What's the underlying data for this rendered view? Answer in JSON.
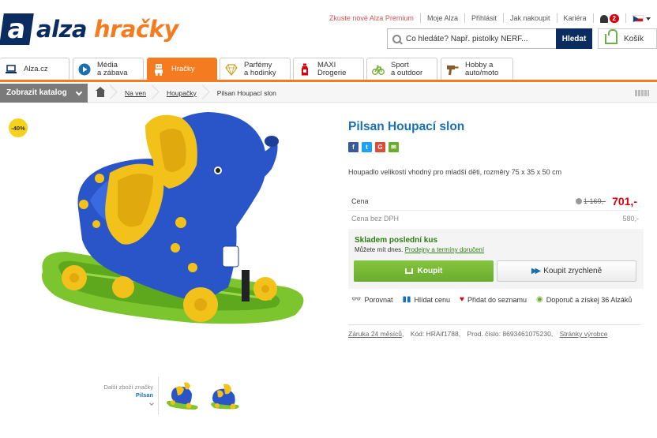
{
  "header": {
    "logo_part1": "alza",
    "logo_part2": "hračky",
    "top_links": [
      "Zkuste nové Alza Premium",
      "Moje Alza",
      "Přihlásit",
      "Jak nakoupit",
      "Kariéra"
    ],
    "notification_count": "2",
    "search_placeholder": "Co hledáte? Např. pistolky NERF...",
    "search_button": "Hledat",
    "cart_label": "Košík"
  },
  "categories": [
    {
      "label": "Alza.cz",
      "icon": "laptop-icon"
    },
    {
      "label": "Média\na zábava",
      "icon": "play-icon"
    },
    {
      "label": "Hračky",
      "icon": "robot-icon"
    },
    {
      "label": "Parfémy\na hodinky",
      "icon": "diamond-icon"
    },
    {
      "label": "MAXI\nDrogerie",
      "icon": "bottle-icon"
    },
    {
      "label": "Sport\na outdoor",
      "icon": "bicycle-icon"
    },
    {
      "label": "Hobby a\nauto/moto",
      "icon": "drill-icon"
    }
  ],
  "breadcrumb": {
    "catalog_button": "Zobrazit katalog",
    "items": [
      "Na ven",
      "Houpačky",
      "Pilsan Houpací slon"
    ]
  },
  "product": {
    "discount": "-40%",
    "title": "Pilsan Houpací slon",
    "description": "Houpadlo velikostí vhodný pro mladší děti, rozměry 75 x 35 x 50 cm",
    "price_label": "Cena",
    "old_price": "1 169,-",
    "price": "701,-",
    "net_label": "Cena bez DPH",
    "net_price": "580,-",
    "stock_title": "Skladem poslední kus",
    "stock_sub_prefix": "Můžete mít dnes.",
    "stock_sub_link": "Prodejny a termíny doručení",
    "buy_label": "Koupit",
    "quick_buy_label": "Koupit zrychleně",
    "actions": [
      "Porovnat",
      "Hlídat cenu",
      "Přidat do seznamu",
      "Doporuč a získej 36 Alzáků"
    ],
    "warranty": "Záruka 24 měsíců",
    "code": "Kód: HRAif1788,",
    "prod_no": "Prod. číslo: 8693461075230,",
    "maker_link": "Stránky výrobce",
    "brand_more_label": "Další zboží značky",
    "brand_name": "Pilsan"
  },
  "colors": {
    "brand_blue": "#0b2c60",
    "brand_orange": "#f47b20",
    "link_blue": "#1a6fb4",
    "price_red": "#d9000d",
    "buy_green": "#6aac2c"
  }
}
